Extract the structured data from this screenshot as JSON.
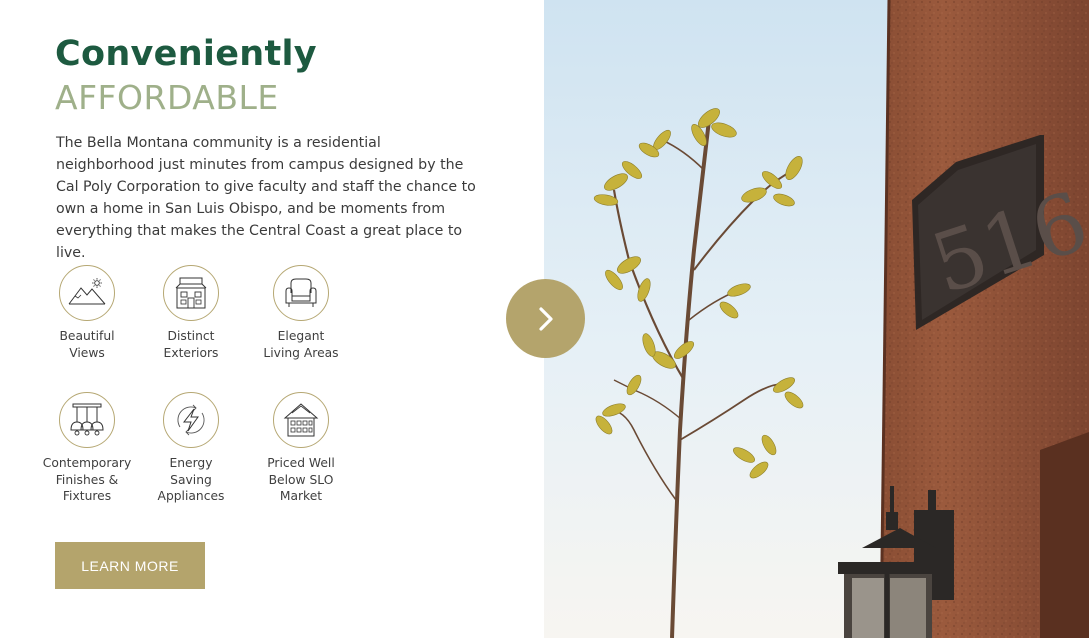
{
  "heading": {
    "main": "Conveniently",
    "sub": "AFFORDABLE"
  },
  "intro_text": "The Bella Montana community is a residential neighborhood just minutes from campus designed by the Cal Poly Corporation to give faculty and staff the chance to own a home in San Luis Obispo, and be moments from everything that makes the Central Coast a great place to live.",
  "features": [
    {
      "label": "Beautiful\nViews",
      "icon": "mountain-sun-icon"
    },
    {
      "label": "Distinct\nExteriors",
      "icon": "house-icon"
    },
    {
      "label": "Elegant\nLiving Areas",
      "icon": "armchair-icon"
    },
    {
      "label": "Contemporary\nFinishes &\nFixtures",
      "icon": "pendant-lights-icon"
    },
    {
      "label": "Energy\nSaving\nAppliances",
      "icon": "energy-bolt-icon"
    },
    {
      "label": "Priced Well\nBelow SLO\nMarket",
      "icon": "building-icon"
    }
  ],
  "cta": {
    "label": "LEARN MORE"
  },
  "photo": {
    "house_number": "516"
  },
  "colors": {
    "brand_green": "#1d5a40",
    "sage": "#9fb08a",
    "gold": "#b4a46c"
  },
  "icons": {
    "next": "chevron-right-icon"
  }
}
